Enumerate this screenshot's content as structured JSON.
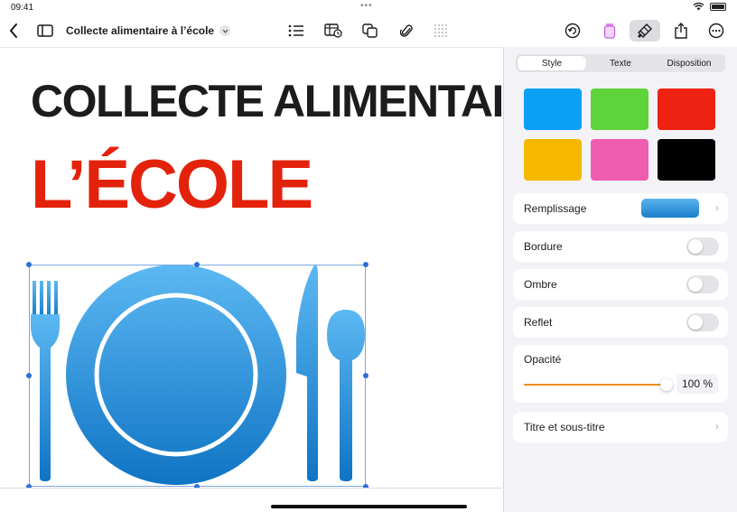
{
  "status": {
    "time": "09:41"
  },
  "document": {
    "title": "Collecte alimentaire à l’école"
  },
  "canvas": {
    "headline_line1": "COLLECTE ALIMENTAIRE À",
    "headline_line2": "L’ÉCOLE",
    "headline_color_1": "#1c1c1e",
    "headline_color_2": "#e3220c",
    "graphic": {
      "type": "plate-fork-knife-spoon",
      "color_top": "#5cb8f2",
      "color_bottom": "#0f74c4"
    }
  },
  "inspector": {
    "tabs": [
      {
        "label": "Style",
        "active": true
      },
      {
        "label": "Texte",
        "active": false
      },
      {
        "label": "Disposition",
        "active": false
      }
    ],
    "swatches": [
      "#0aa1f5",
      "#5fd43a",
      "#ee2212",
      "#f7b900",
      "#ef5db0",
      "#000000"
    ],
    "fill": {
      "label": "Remplissage"
    },
    "border": {
      "label": "Bordure",
      "on": false
    },
    "shadow": {
      "label": "Ombre",
      "on": false
    },
    "reflection": {
      "label": "Reflet",
      "on": false
    },
    "opacity": {
      "label": "Opacité",
      "value_text": "100 %",
      "value": 100
    },
    "title_caption": {
      "label": "Titre et sous-titre"
    }
  }
}
